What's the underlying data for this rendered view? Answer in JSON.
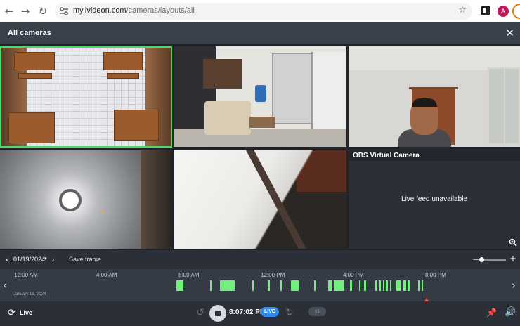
{
  "browser": {
    "url_host": "my.ivideon.com",
    "url_path": "/cameras/layouts/all",
    "avatar_letter": "A",
    "icons": [
      "back-icon",
      "forward-icon",
      "reload-icon",
      "site-settings-icon",
      "star-icon",
      "side-panel-icon"
    ]
  },
  "header": {
    "title": "All cameras",
    "close_glyph": "✕"
  },
  "cameras": [
    {
      "name": "",
      "state": "live",
      "selected": true
    },
    {
      "name": "",
      "state": "live",
      "selected": false
    },
    {
      "name": "",
      "state": "live",
      "selected": false
    },
    {
      "name": "",
      "state": "live",
      "selected": false
    },
    {
      "name": "",
      "state": "live",
      "selected": false
    },
    {
      "name": "OBS Virtual Camera",
      "state": "unavailable",
      "message": "Live feed unavailable",
      "selected": false
    }
  ],
  "toolbar": {
    "date": "01/19/2024",
    "save_frame": "Save frame",
    "zoom_level": 0.05
  },
  "timeline": {
    "ticks": [
      "12:00 AM",
      "4:00 AM",
      "8:00 AM",
      "12:00 PM",
      "4:00 PM",
      "8:00 PM"
    ],
    "date_label": "January 19, 2024",
    "record_color": "#72f07e",
    "playhead_color": "#ff4d4d"
  },
  "bottombar": {
    "live_label": "Live",
    "time": "8:07:02 PM",
    "live_badge": "LIVE",
    "speed": "x1",
    "badge_color": "#2d8cf0"
  },
  "colors": {
    "selection": "#4cd964",
    "background": "#2b3038"
  }
}
